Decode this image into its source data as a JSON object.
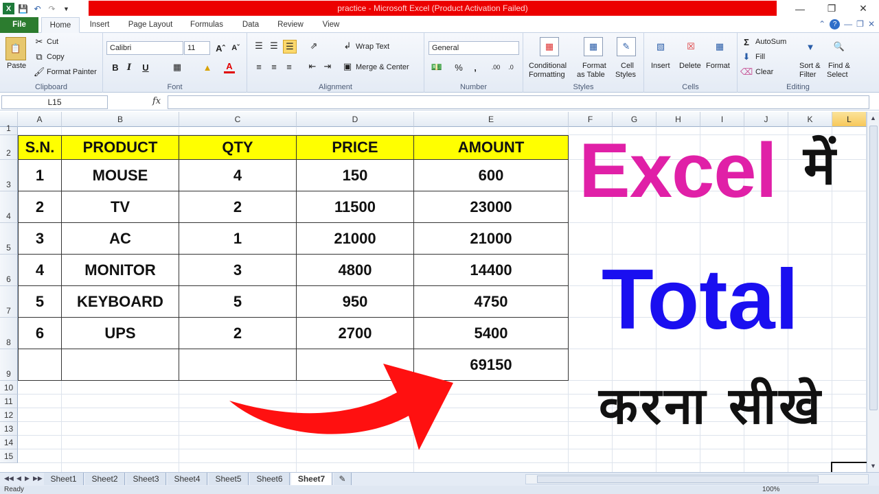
{
  "window": {
    "title": "practice  -  Microsoft Excel (Product Activation Failed)",
    "accent": "#ec0000"
  },
  "tabs": [
    "File",
    "Home",
    "Insert",
    "Page Layout",
    "Formulas",
    "Data",
    "Review",
    "View"
  ],
  "ribbon": {
    "clipboard": {
      "name": "Clipboard",
      "paste": "Paste",
      "cut": "Cut",
      "copy": "Copy",
      "format_painter": "Format Painter"
    },
    "font": {
      "name": "Font",
      "family": "Calibri",
      "size": "11"
    },
    "alignment": {
      "name": "Alignment",
      "wrap": "Wrap Text",
      "merge": "Merge & Center"
    },
    "number": {
      "name": "Number",
      "format": "General"
    },
    "styles": {
      "name": "Styles",
      "conditional": "Conditional",
      "conditional2": "Formatting",
      "format_table": "Format",
      "format_table2": "as Table",
      "cell_styles": "Cell",
      "cell_styles2": "Styles"
    },
    "cells": {
      "name": "Cells",
      "insert": "Insert",
      "delete": "Delete",
      "format": "Format"
    },
    "editing": {
      "name": "Editing",
      "autosum": "AutoSum",
      "fill": "Fill",
      "clear": "Clear",
      "sort": "Sort &",
      "sort2": "Filter",
      "find": "Find &",
      "find2": "Select"
    }
  },
  "formula_bar": {
    "name_box": "L15",
    "fx": "fx",
    "value": ""
  },
  "columns": [
    "A",
    "B",
    "C",
    "D",
    "E",
    "F",
    "G",
    "H",
    "I",
    "J",
    "K",
    "L"
  ],
  "rows": [
    "1",
    "2",
    "3",
    "4",
    "5",
    "6",
    "7",
    "8",
    "9",
    "10",
    "11",
    "12",
    "13",
    "14",
    "15"
  ],
  "table": {
    "headers": [
      "S.N.",
      "PRODUCT",
      "QTY",
      "PRICE",
      "AMOUNT"
    ],
    "header_color": "#ffff00",
    "rows": [
      [
        "1",
        "MOUSE",
        "4",
        "150",
        "600"
      ],
      [
        "2",
        "TV",
        "2",
        "11500",
        "23000"
      ],
      [
        "3",
        "AC",
        "1",
        "21000",
        "21000"
      ],
      [
        "4",
        "MONITOR",
        "3",
        "4800",
        "14400"
      ],
      [
        "5",
        "KEYBOARD",
        "5",
        "950",
        "4750"
      ],
      [
        "6",
        "UPS",
        "2",
        "2700",
        "5400"
      ]
    ],
    "total": "69150"
  },
  "overlay": {
    "excel": "Excel",
    "mein": "में",
    "total": "Total",
    "karna": "करना सीखे",
    "excel_color": "#e020a7",
    "total_color": "#1a0ff0",
    "arrow_color": "#ff1010"
  },
  "sheets": [
    "Sheet1",
    "Sheet2",
    "Sheet3",
    "Sheet4",
    "Sheet5",
    "Sheet6",
    "Sheet7"
  ],
  "active_sheet": "Sheet7",
  "status": {
    "ready": "Ready",
    "zoom": "100%"
  }
}
